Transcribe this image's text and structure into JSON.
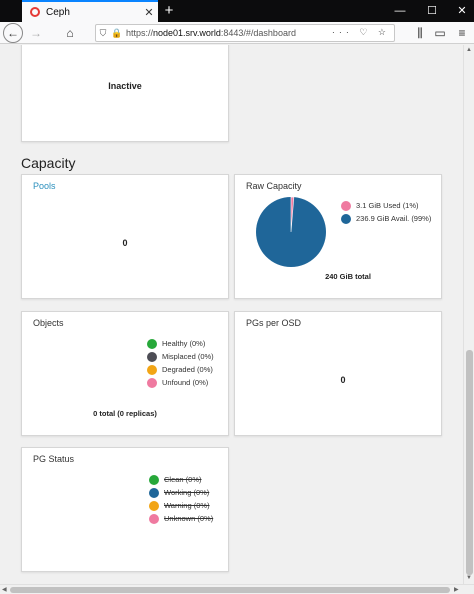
{
  "browser": {
    "tab_title": "Ceph",
    "new_tab": "+",
    "window_controls": [
      "—",
      "☐",
      "✕"
    ],
    "url_scheme": "https://",
    "url_host": "node01.srv.world",
    "url_rest": ":8443/#/dashboard",
    "url_right_icons": "··· ♡ ☆",
    "nav_icons": [
      "back-arrow-icon",
      "forward-arrow-icon",
      "home-icon",
      "shield-icon",
      "lock-icon",
      "library-icon",
      "reader-icon",
      "menu-icon"
    ]
  },
  "dashboard": {
    "top_card_value": "Inactive",
    "capacity_section_title": "Capacity",
    "pools": {
      "title": "Pools",
      "value": "0"
    },
    "raw_capacity": {
      "title": "Raw Capacity",
      "used_label": "3.1 GiB Used (1%)",
      "avail_label": "236.9 GiB Avail. (99%)",
      "total_label": "240 GiB total",
      "used_fraction": 0.013,
      "used_color": "#ef7aa0",
      "avail_color": "#1f6699"
    },
    "objects": {
      "title": "Objects",
      "legend": [
        {
          "label": "Healthy (0%)",
          "color": "#27a83a"
        },
        {
          "label": "Misplaced (0%)",
          "color": "#4d4d55"
        },
        {
          "label": "Degraded (0%)",
          "color": "#f2a516"
        },
        {
          "label": "Unfound (0%)",
          "color": "#ef7aa0"
        }
      ],
      "total_label": "0 total (0 replicas)"
    },
    "pgs_per_osd": {
      "title": "PGs per OSD",
      "value": "0"
    },
    "pg_status": {
      "title": "PG Status",
      "legend": [
        {
          "label": "Clean (0%)",
          "color": "#27a83a"
        },
        {
          "label": "Working (0%)",
          "color": "#1f6699"
        },
        {
          "label": "Warning (0%)",
          "color": "#f2a516"
        },
        {
          "label": "Unknown (0%)",
          "color": "#ef7aa0"
        }
      ]
    }
  }
}
